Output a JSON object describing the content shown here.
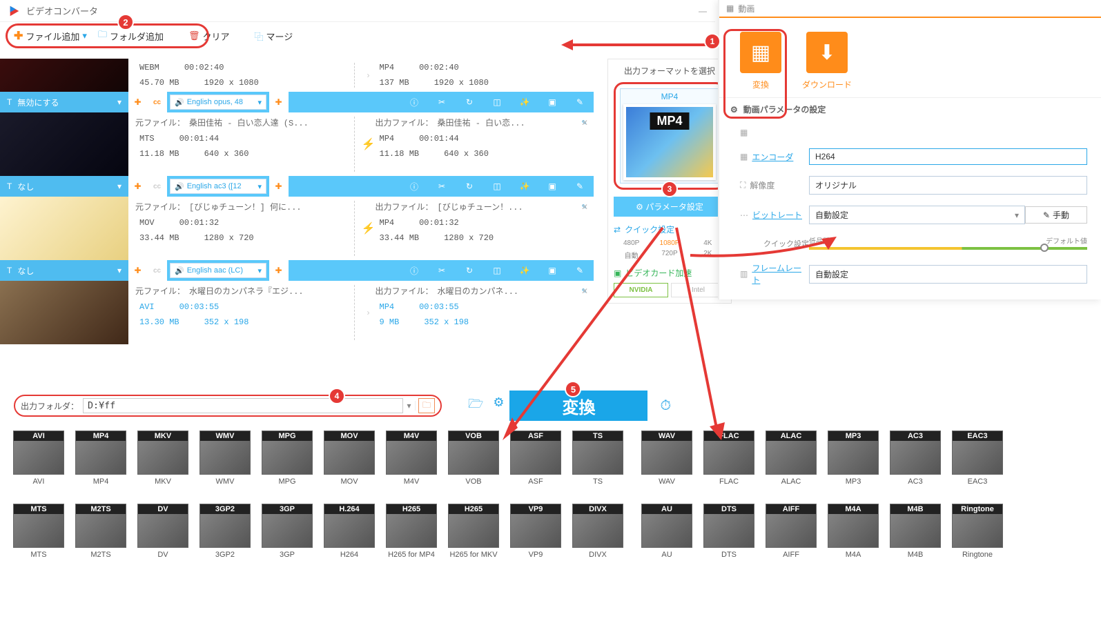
{
  "app": {
    "title": "ビデオコンバータ",
    "video_tab": "動画"
  },
  "window_controls": {
    "minimize": "—",
    "close": "✕"
  },
  "toolbar": {
    "add_file": "ファイル追加",
    "add_folder": "フォルダ追加",
    "clear": "クリア",
    "merge": "マージ"
  },
  "callouts": {
    "c1": "1",
    "c2": "2",
    "c3": "3",
    "c4": "4",
    "c5": "5"
  },
  "files": [
    {
      "disable": "無効にする",
      "lang": "English opus, 48",
      "src": {
        "fmt": "WEBM",
        "dur": "00:02:40",
        "size": "45.70 MB",
        "res": "1920 x 1080"
      },
      "out": {
        "fmt": "MP4",
        "dur": "00:02:40",
        "size": "137 MB",
        "res": "1920 x 1080"
      }
    },
    {
      "disable": "なし",
      "lang": "English ac3 ([12",
      "src_name": "元ファイル：　桑田佳祐 - 白い恋人達 (S...",
      "out_name": "出力ファイル：　桑田佳祐 - 白い恋...",
      "src": {
        "fmt": "MTS",
        "dur": "00:01:44",
        "size": "11.18 MB",
        "res": "640 x 360"
      },
      "out": {
        "fmt": "MP4",
        "dur": "00:01:44",
        "size": "11.18 MB",
        "res": "640 x 360"
      }
    },
    {
      "disable": "なし",
      "lang": "English aac (LC)",
      "src_name": "元ファイル：　[びじゅチューン！] 何に...",
      "out_name": "出力ファイル：　[びじゅチューン！...",
      "src": {
        "fmt": "MOV",
        "dur": "00:01:32",
        "size": "33.44 MB",
        "res": "1280 x 720"
      },
      "out": {
        "fmt": "MP4",
        "dur": "00:01:32",
        "size": "33.44 MB",
        "res": "1280 x 720"
      }
    },
    {
      "src_name": "元ファイル：　水曜日のカンパネラ『エジ...",
      "out_name": "出力ファイル：　水曜日のカンパネ...",
      "src": {
        "fmt": "AVI",
        "dur": "00:03:55",
        "size": "13.30 MB",
        "res": "352 x 198"
      },
      "out": {
        "fmt": "MP4",
        "dur": "00:03:55",
        "size": "9 MB",
        "res": "352 x 198"
      }
    }
  ],
  "labels": {
    "src": "元ファイル：",
    "out": "出力ファイル："
  },
  "right_panel": {
    "title": "出力フォーマットを選択",
    "fmt": "MP4",
    "param_btn": "パラメータ設定",
    "quick_title": "クイック設定",
    "quick_opts": [
      "480P",
      "1080P",
      "4K",
      "自動",
      "720P",
      "2K"
    ],
    "gpu_title": "ビデオカード加速",
    "gpu": [
      "NVIDIA",
      "Intel"
    ]
  },
  "output_folder": {
    "label": "出力フォルダ：",
    "path": "D:¥ff"
  },
  "convert_btn": "変換",
  "overlay": {
    "tab": "動画",
    "mode_convert": "変換",
    "mode_download": "ダウンロード",
    "section": "動画パラメータの設定",
    "encoder_lbl": "エンコーダ",
    "encoder_val": "H264",
    "resolution_lbl": "解像度",
    "resolution_val": "オリジナル",
    "bitrate_lbl": "ビットレート",
    "bitrate_val": "自動設定",
    "manual_btn": "手動",
    "quick_lbl": "クイック設定",
    "quality_low": "低品質",
    "quality_default": "デフォルト値",
    "framerate_lbl": "フレームレート",
    "framerate_val": "自動設定"
  },
  "video_formats_1": [
    "AVI",
    "MP4",
    "MKV",
    "WMV",
    "MPG",
    "MOV",
    "M4V",
    "VOB",
    "ASF",
    "TS"
  ],
  "video_formats_2": [
    "MTS",
    "M2TS",
    "DV",
    "3GP2",
    "3GP",
    "H264",
    "H265 for MP4",
    "H265 for MKV",
    "VP9",
    "DIVX"
  ],
  "video_tags_2": [
    "MTS",
    "M2TS",
    "DV",
    "3GP2",
    "3GP",
    "H.264",
    "H265",
    "H265",
    "VP9",
    "DIVX"
  ],
  "audio_formats_1": [
    "WAV",
    "FLAC",
    "ALAC",
    "MP3",
    "AC3",
    "EAC3"
  ],
  "audio_formats_2": [
    "AU",
    "DTS",
    "AIFF",
    "M4A",
    "M4B",
    "Ringtone"
  ]
}
